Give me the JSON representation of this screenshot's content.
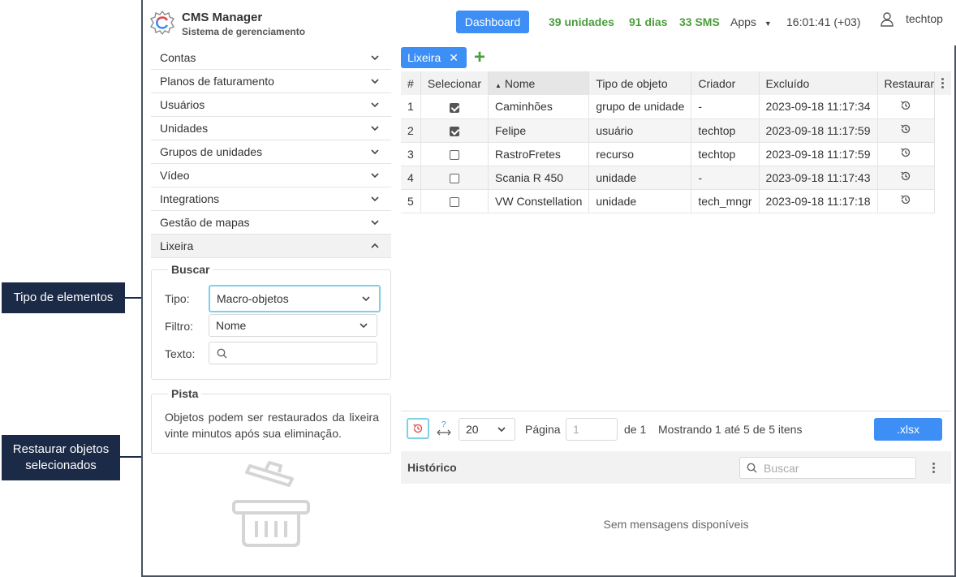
{
  "callouts": {
    "tipo_elementos": "Tipo de elementos",
    "restaurar_line1": "Restaurar objetos",
    "restaurar_line2": "selecionados"
  },
  "header": {
    "app_title": "CMS Manager",
    "app_subtitle": "Sistema de gerenciamento",
    "dashboard_label": "Dashboard",
    "units": "39 unidades",
    "days": "91 dias",
    "sms": "33 SMS",
    "apps": "Apps",
    "time": "16:01:41 (+03)",
    "user": "techtop"
  },
  "sidebar": {
    "items": [
      {
        "label": "Contas"
      },
      {
        "label": "Planos de faturamento"
      },
      {
        "label": "Usuários"
      },
      {
        "label": "Unidades"
      },
      {
        "label": "Grupos de unidades"
      },
      {
        "label": "Vídeo"
      },
      {
        "label": "Integrations"
      },
      {
        "label": "Gestão de mapas"
      },
      {
        "label": "Lixeira"
      }
    ],
    "search": {
      "legend": "Buscar",
      "type_label": "Tipo:",
      "type_value": "Macro-objetos",
      "filter_label": "Filtro:",
      "filter_value": "Nome",
      "text_label": "Texto:"
    },
    "hint": {
      "legend": "Pista",
      "text": "Objetos podem ser restaurados da lixeira vinte minutos após sua eliminação."
    }
  },
  "main": {
    "tab_label": "Lixeira",
    "columns": [
      "#",
      "Selecionar",
      "Nome",
      "Tipo de objeto",
      "Criador",
      "Excluído",
      "Restaurar"
    ],
    "rows": [
      {
        "n": "1",
        "checked": true,
        "name": "Caminhões",
        "type": "grupo de unidade",
        "creator": "-",
        "deleted": "2023-09-18 11:17:34"
      },
      {
        "n": "2",
        "checked": true,
        "name": "Felipe",
        "type": "usuário",
        "creator": "techtop",
        "deleted": "2023-09-18 11:17:59"
      },
      {
        "n": "3",
        "checked": false,
        "name": "RastroFretes",
        "type": "recurso",
        "creator": "techtop",
        "deleted": "2023-09-18 11:17:59"
      },
      {
        "n": "4",
        "checked": false,
        "name": "Scania R 450",
        "type": "unidade",
        "creator": "-",
        "deleted": "2023-09-18 11:17:43"
      },
      {
        "n": "5",
        "checked": false,
        "name": "VW Constellation",
        "type": "unidade",
        "creator": "tech_mngr",
        "deleted": "2023-09-18 11:17:18"
      }
    ],
    "pager": {
      "page_size": "20",
      "page_label": "Página",
      "page_value": "1",
      "of_label": "de 1",
      "showing": "Mostrando 1 até 5 de 5 itens",
      "export_label": ".xlsx"
    },
    "history": {
      "title": "Histórico",
      "search_placeholder": "Buscar",
      "empty": "Sem mensagens disponíveis"
    }
  },
  "colors": {
    "accent": "#3d8ef5",
    "green": "#4a9e3b",
    "callout_bg": "#1b2a47",
    "highlight": "#7fd0e6"
  }
}
